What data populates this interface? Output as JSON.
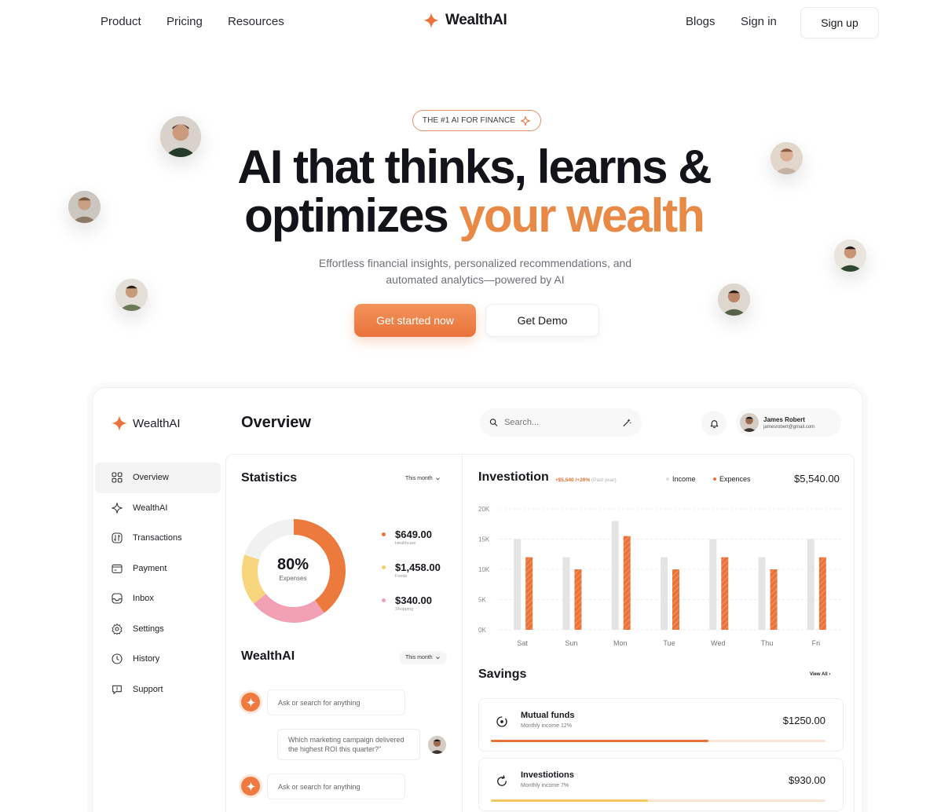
{
  "nav": {
    "links_left": [
      "Product",
      "Pricing",
      "Resources"
    ],
    "brand": "WealthAI",
    "links_right": [
      "Blogs",
      "Sign in"
    ],
    "signup": "Sign up"
  },
  "hero": {
    "badge": "THE #1 AI FOR FINANCE",
    "title_line1": "AI that thinks, learns &",
    "title_line2_a": "optimizes ",
    "title_line2_b": "your wealth",
    "subtitle_line1": "Effortless financial insights, personalized recommendations, and",
    "subtitle_line2": "automated analytics—powered by AI",
    "cta_primary": "Get started now",
    "cta_secondary": "Get Demo"
  },
  "dashboard": {
    "brand": "WealthAI",
    "page_title": "Overview",
    "search_placeholder": "Search...",
    "user": {
      "name": "James Robert",
      "email": "jamesrobert@gmail.com"
    },
    "sidebar": [
      {
        "label": "Overview",
        "icon": "grid-icon",
        "active": true
      },
      {
        "label": "WealthAI",
        "icon": "sparkle-icon"
      },
      {
        "label": "Transactions",
        "icon": "transactions-icon"
      },
      {
        "label": "Payment",
        "icon": "payment-icon"
      },
      {
        "label": "Inbox",
        "icon": "inbox-icon"
      },
      {
        "label": "Settings",
        "icon": "gear-icon"
      },
      {
        "label": "History",
        "icon": "clock-icon"
      },
      {
        "label": "Support",
        "icon": "chat-icon"
      }
    ],
    "statistics": {
      "title": "Statistics",
      "period": "This month",
      "percent": "80%",
      "percent_label": "Expenses",
      "items": [
        {
          "amount": "$649.00",
          "category": "Healthcare",
          "color": "#e9733a"
        },
        {
          "amount": "$1,458.00",
          "category": "Foods",
          "color": "#f6cf6b"
        },
        {
          "amount": "$340.00",
          "category": "Shopping",
          "color": "#f2a0b4"
        }
      ],
      "ring": [
        {
          "color": "#ec7a3c",
          "value": 0.4
        },
        {
          "color": "#f2a0b4",
          "value": 0.24
        },
        {
          "color": "#f6d57c",
          "value": 0.16
        },
        {
          "color": "#f1f1f1",
          "value": 0.2
        }
      ]
    },
    "wealthai": {
      "title": "WealthAI",
      "period": "This month",
      "prompt1": "Ask or search for anything",
      "question_line1": "Which marketing campaign delivered",
      "question_line2": "the highest ROI this quarter?\"",
      "prompt2": "Ask or search for anything"
    },
    "investment": {
      "title": "Investiotion",
      "delta": "+$5,540 /+20%",
      "delta_note": "(Past year)",
      "legend_income": "Income",
      "legend_expenses": "Expences",
      "total": "$5,540.00"
    },
    "savings": {
      "title": "Savings",
      "view_all": "View All",
      "items": [
        {
          "name": "Mutual funds",
          "sub": "Monthly income 12%",
          "amount": "$1250.00",
          "progress": 0.65,
          "color": "#e9733a"
        },
        {
          "name": "Investiotions",
          "sub": "Monthly income 7%",
          "amount": "$930.00",
          "progress": 0.47,
          "color": "#f6c95f"
        }
      ]
    }
  },
  "chart_data": {
    "type": "bar",
    "categories": [
      "Sat",
      "Sun",
      "Mon",
      "Tue",
      "Wed",
      "Thu",
      "Fri"
    ],
    "series": [
      {
        "name": "Income",
        "values": [
          15000,
          12000,
          18000,
          12000,
          15000,
          12000,
          15000
        ],
        "color": "#e4e4e4"
      },
      {
        "name": "Expences",
        "values": [
          12000,
          10000,
          15500,
          10000,
          12000,
          10000,
          12000
        ],
        "color": "#e9733a"
      }
    ],
    "yticks": [
      "0K",
      "5K",
      "10K",
      "15K",
      "20K"
    ],
    "ylim": [
      0,
      20000
    ],
    "grid": true,
    "legend": "top"
  }
}
